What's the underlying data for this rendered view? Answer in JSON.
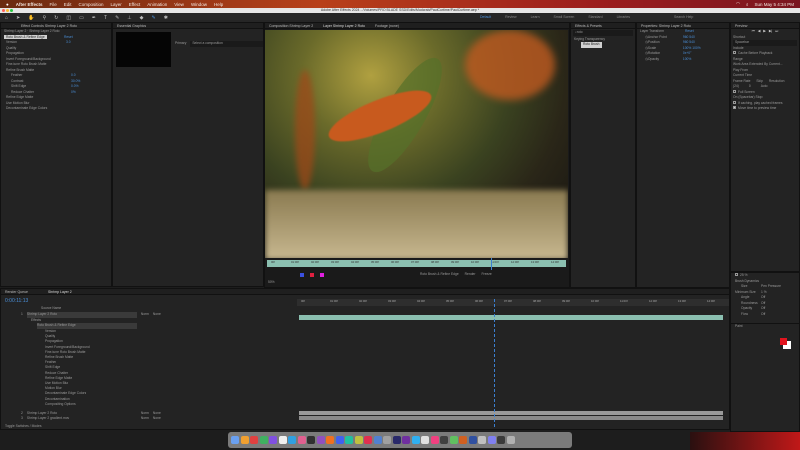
{
  "menubar": {
    "items": [
      "After Effects",
      "File",
      "Edit",
      "Composition",
      "Layer",
      "Effect",
      "Animation",
      "View",
      "Window",
      "Help"
    ],
    "clock": "Sun May 5  4:34 PM"
  },
  "window": {
    "title": "Adobe After Effects 2024 - /Volumes/PRO BLADE SSD/Edits/Mudcrab/PaulCurtime/PaulCurtime.aep *"
  },
  "workspaces": [
    "Default",
    "Review",
    "Learn",
    "Small Screen",
    "Standard",
    "Libraries"
  ],
  "search_placeholder": "Search Help",
  "effect_controls": {
    "tab": "Effect Controls Shrimp Layer 2 Roto",
    "layer": "Shrimp Layer 2 · Shrimp Layer 2 Roto",
    "effect": "Roto Brush & Refine Edge",
    "reset": "Reset",
    "rows": [
      {
        "l": "Version",
        "v": "3.0"
      },
      {
        "l": "Quality",
        "v": ""
      },
      {
        "l": "Propagation",
        "v": ""
      },
      {
        "l": "Invert Foreground/Background",
        "v": ""
      },
      {
        "l": "Fine-tune Roto Brush Matte",
        "v": ""
      },
      {
        "l": "Refine Brush Matte",
        "v": ""
      },
      {
        "l": "Feather",
        "v": "0.0"
      },
      {
        "l": "Contrast",
        "v": "30.0%"
      },
      {
        "l": "Shift Edge",
        "v": "0.0%"
      },
      {
        "l": "Reduce Chatter",
        "v": "0%"
      },
      {
        "l": "Refine Edge Matte",
        "v": ""
      },
      {
        "l": "Use Motion Blur",
        "v": ""
      },
      {
        "l": "Decontaminate Edge Colors",
        "v": ""
      }
    ]
  },
  "essential_graphics": {
    "tab": "Essential Graphics",
    "primary_label": "Primary",
    "primary_value": "Select a composition"
  },
  "viewer": {
    "tabs": [
      "Composition Shrimp Layer 2",
      "Layer Shrimp Layer 2 Roto",
      "Footage (none)"
    ],
    "zoom": "50%",
    "view": "Roto Brush & Refine Edge",
    "render_label": "Render",
    "freeze_label": "Freeze",
    "ticks": [
      "00f",
      "01:00f",
      "02:00f",
      "03:00f",
      "04:00f",
      "05:00f",
      "06:00f",
      "07:00f",
      "08:00f",
      "09:00f",
      "10:00f",
      "11:00f",
      "12:00f",
      "13:00f",
      "14:00f"
    ]
  },
  "effects_presets": {
    "title": "Effects & Presets",
    "search": "roto",
    "category": "Keying Transparency",
    "item": "Roto Brush"
  },
  "properties": {
    "title": "Properties: Shrimp Layer 2 Roto",
    "section": "Layer Transform",
    "reset": "Reset",
    "rows": [
      {
        "l": "Anchor Point",
        "v": "960  540"
      },
      {
        "l": "Position",
        "v": "960  540"
      },
      {
        "l": "Scale",
        "v": "100%  100%"
      },
      {
        "l": "Rotation",
        "v": "0x+0°"
      },
      {
        "l": "Opacity",
        "v": "100%"
      }
    ]
  },
  "preview": {
    "title": "Preview",
    "shortcut_label": "Shortcut",
    "shortcut": "Spacebar",
    "include_label": "Include",
    "cache_label": "Cache Before Playback",
    "range_label": "Range",
    "range": "Work Area Extended By Current...",
    "play_from_label": "Play From",
    "play_from": "Current Time",
    "frame_rate_label": "Frame Rate",
    "frame_rate": "(24)",
    "skip_label": "Skip",
    "skip": "0",
    "resolution_label": "Resolution",
    "resolution": "Auto",
    "fullscreen_label": "Full Screen",
    "on_stop_label": "On (Spacebar) Stop:",
    "if_caching": "If caching, play cached frames",
    "move_time": "Move time to preview time"
  },
  "brush": {
    "spacing": "25 %",
    "diameter_label": "Brush Dynamics",
    "size_label": "Size",
    "size": "Pen Pressure",
    "min_size_label": "Minimum Size",
    "min_size": "1 %",
    "angle_label": "Angle",
    "angle": "Off",
    "roundness_label": "Roundness",
    "roundness": "Off",
    "opacity_label": "Opacity",
    "opacity": "Off",
    "flow_label": "Flow",
    "flow": "Off",
    "paint_title": "Paint",
    "fg_color": "#e0141e"
  },
  "timeline": {
    "tabs": [
      "Render Queue",
      "Shrimp Layer 2"
    ],
    "timecode": "0:00:11:13",
    "source_header": "Source Name",
    "effects_label": "Effects",
    "effect": "Roto Brush & Refine Edge",
    "rows": [
      "Version",
      "Quality",
      "Propagation",
      "Invert Foreground/Background",
      "Fine-tune Roto Brush Matte",
      "Refine Brush Matte",
      "Feather",
      "Shift Edge",
      "Reduce Chatter",
      "Refine Edge Matte",
      "Use Motion Blur",
      "Motion Blur",
      "Decontaminate Edge Colors",
      "Decontamination",
      "Compositing Options"
    ],
    "layers": [
      {
        "num": "1",
        "name": "Shrimp Layer 2 Roto",
        "mode": "Norm",
        "parent": "None"
      },
      {
        "num": "2",
        "name": "Shrimp Layer 2 Roto",
        "mode": "Norm",
        "parent": "None"
      },
      {
        "num": "3",
        "name": "Shrimp Layer 2 gradient.mov",
        "mode": "Norm",
        "parent": "None"
      }
    ],
    "toggle_label": "Toggle Switches / Modes",
    "progress": 0.27
  }
}
